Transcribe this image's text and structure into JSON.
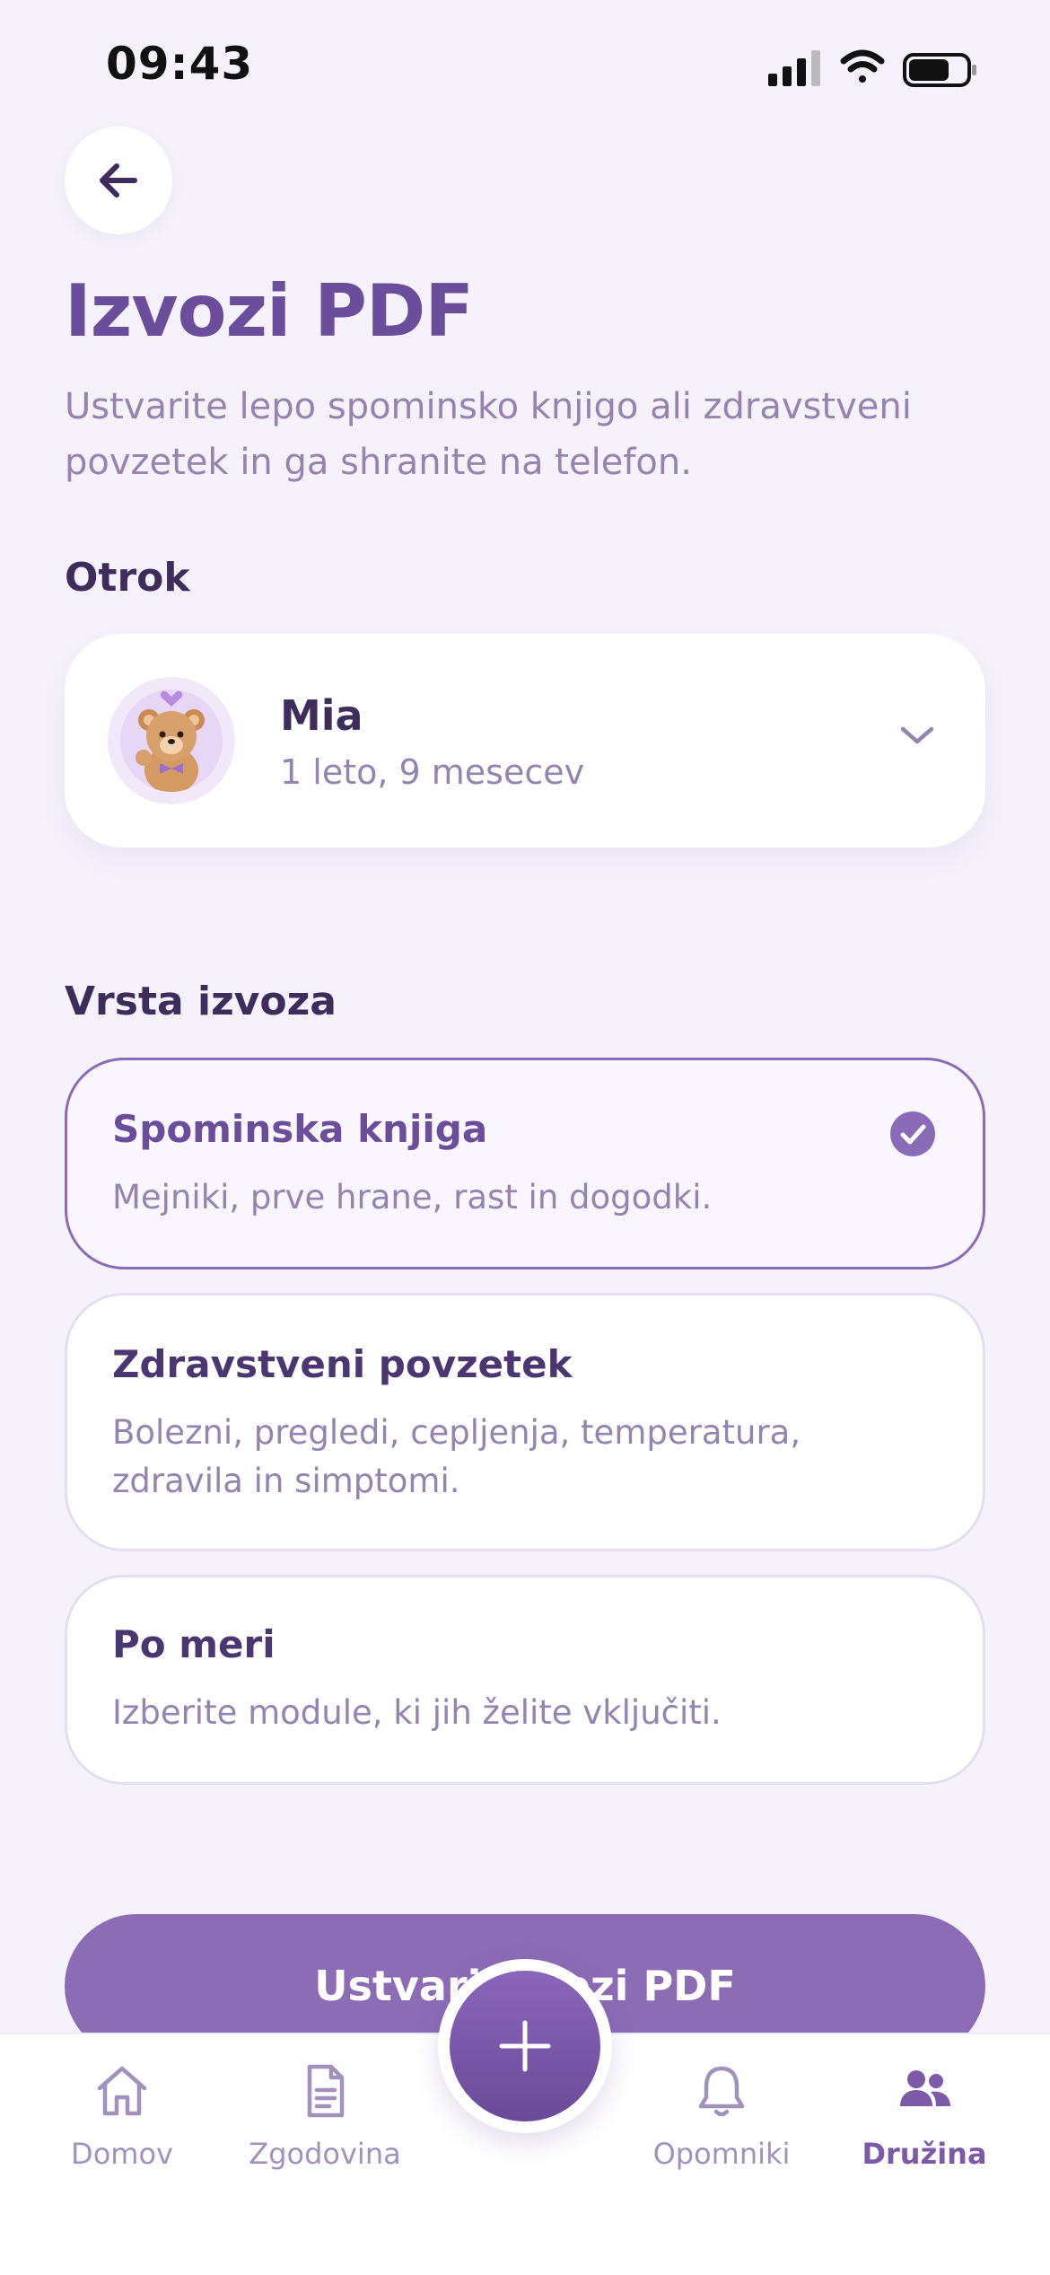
{
  "status_bar": {
    "time": "09:43"
  },
  "header": {
    "title": "Izvozi PDF",
    "subtitle": "Ustvarite lepo spominsko knjigo ali zdravstveni povzetek in ga shranite na telefon."
  },
  "child_section": {
    "label": "Otrok",
    "child": {
      "name": "Mia",
      "age": "1 leto, 9 mesecev"
    }
  },
  "export_section": {
    "label": "Vrsta izvoza",
    "options": [
      {
        "title": "Spominska knjiga",
        "description": "Mejniki, prve hrane, rast in dogodki.",
        "selected": true
      },
      {
        "title": "Zdravstveni povzetek",
        "description": "Bolezni, pregledi, cepljenja, temperatura, zdravila in simptomi.",
        "selected": false
      },
      {
        "title": "Po meri",
        "description": "Izberite module, ki jih želite vključiti.",
        "selected": false
      }
    ]
  },
  "cta": {
    "label": "Ustvari Izvozi PDF"
  },
  "nav": {
    "items": [
      {
        "label": "Domov",
        "icon": "home-icon",
        "active": false
      },
      {
        "label": "Zgodovina",
        "icon": "document-icon",
        "active": false
      },
      {
        "label": "Opomniki",
        "icon": "bell-icon",
        "active": false
      },
      {
        "label": "Družina",
        "icon": "family-icon",
        "active": true
      }
    ],
    "fab_icon": "plus-icon"
  },
  "colors": {
    "accent": "#6b4e9b",
    "button": "#8d6cb6",
    "background": "#f5f2fb"
  }
}
